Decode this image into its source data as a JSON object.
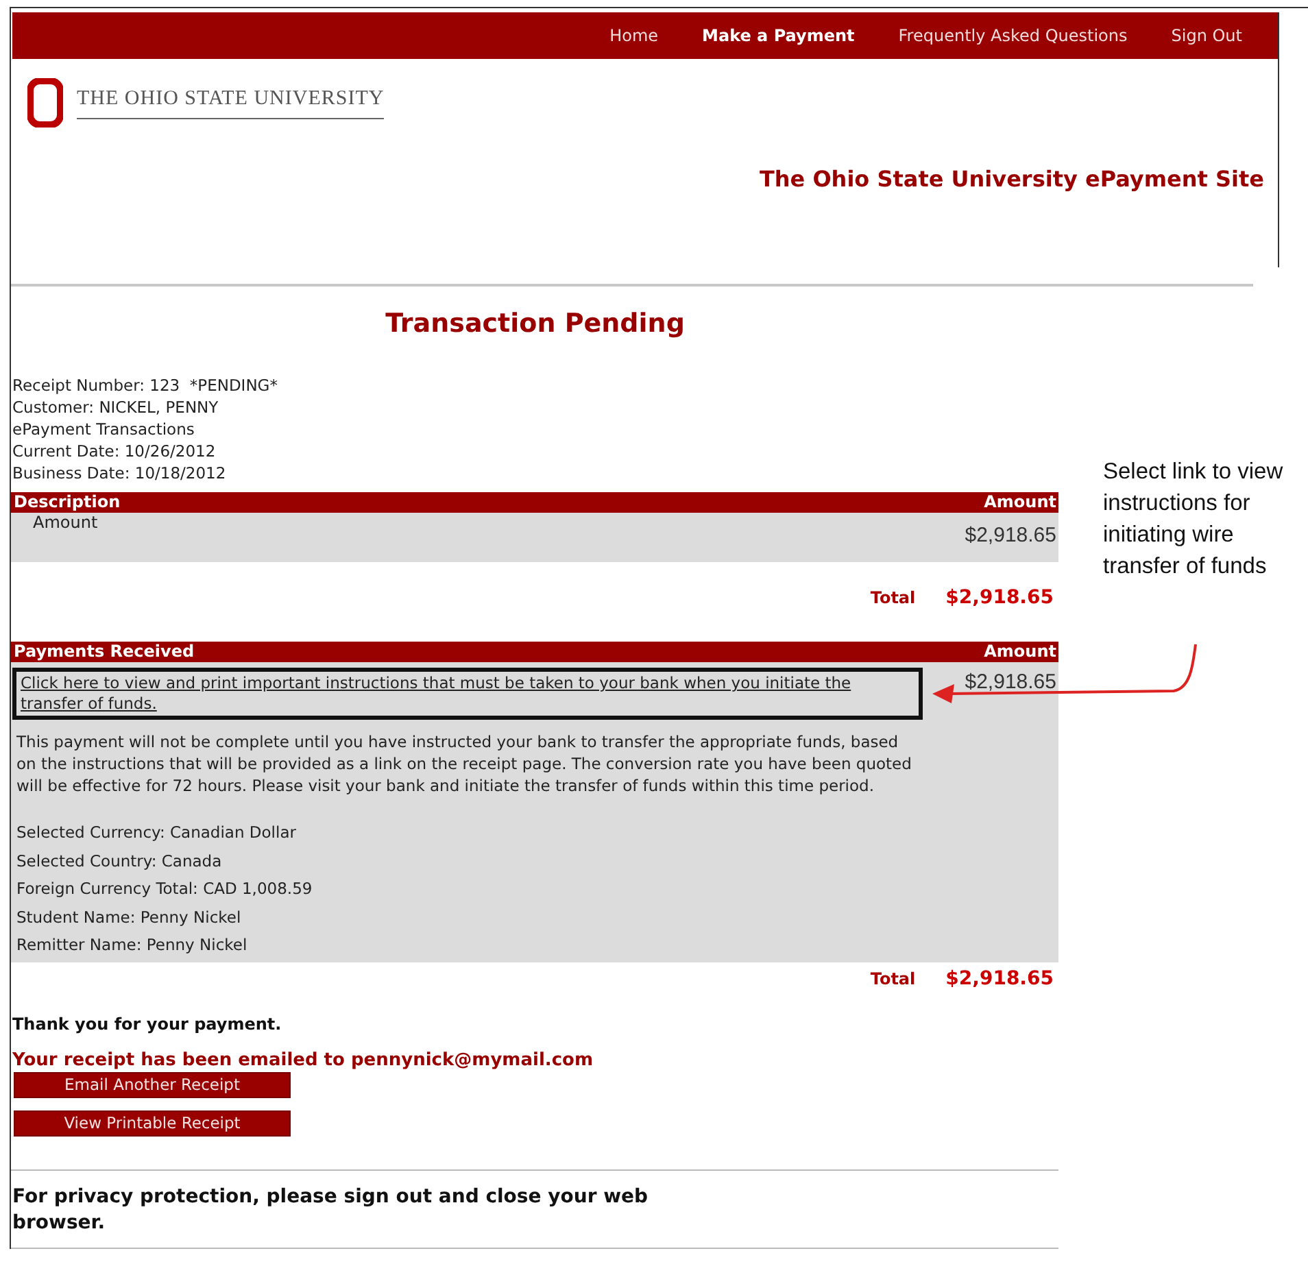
{
  "nav": [
    {
      "label": "Home",
      "selected": false
    },
    {
      "label": "Make a Payment",
      "selected": true
    },
    {
      "label": "Frequently Asked Questions",
      "selected": false
    },
    {
      "label": "Sign Out",
      "selected": false
    }
  ],
  "logo": {
    "text": "THE OHIO STATE UNIVERSITY"
  },
  "site_title": "The Ohio State University ePayment Site",
  "page_title": "Transaction Pending",
  "receipt_info": [
    "Receipt Number: 123  *PENDING*",
    "Customer: NICKEL, PENNY",
    "ePayment Transactions",
    "Current Date: 10/26/2012",
    "Business Date: 10/18/2012"
  ],
  "description_table": {
    "columns": [
      "Description",
      "Amount"
    ],
    "row_label": "Amount",
    "row_amount": "$2,918.65",
    "total_label": "Total",
    "total": "$2,918.65"
  },
  "payments_table": {
    "columns": [
      "Payments Received",
      "Amount"
    ],
    "link": "Click here to view and print important instructions that must be taken to your bank when you initiate the transfer of funds.",
    "amount": "$2,918.65",
    "notice": "This payment will not be complete until you have instructed your bank to transfer the appropriate funds, based on the instructions that will be provided as a link on the receipt page. The conversion rate you have been quoted will be effective for 72 hours. Please visit your bank and initiate the transfer of funds within this time period.",
    "details": [
      "Selected Currency: Canadian Dollar",
      "Selected Country: Canada",
      "Foreign Currency Total: CAD 1,008.59",
      "Student Name: Penny Nickel",
      "Remitter Name: Penny Nickel"
    ],
    "total_label": "Total",
    "total": "$2,918.65"
  },
  "thanks": "Thank you for your payment.",
  "emailed": "Your receipt has been emailed to pennynick@mymail.com",
  "buttons": [
    "Email Another Receipt",
    "View Printable Receipt"
  ],
  "privacy": "For privacy protection, please sign out and close your web browser.",
  "callout": "Select link to view instructions for initiating wire transfer of funds"
}
